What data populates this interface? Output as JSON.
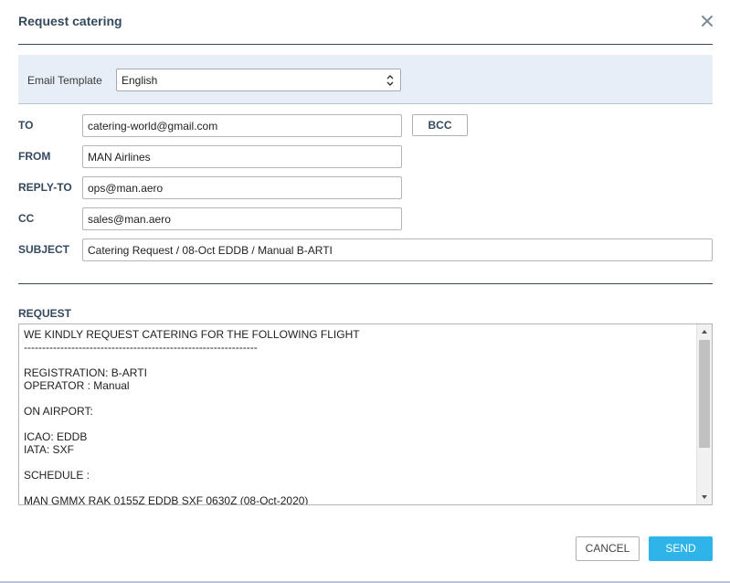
{
  "dialog": {
    "title": "Request catering",
    "close_icon": "close-icon"
  },
  "template": {
    "label": "Email Template",
    "selected": "English"
  },
  "fields": {
    "to": {
      "label": "TO",
      "value": "catering-world@gmail.com"
    },
    "bcc_label": "BCC",
    "from": {
      "label": "FROM",
      "value": "MAN Airlines"
    },
    "reply_to": {
      "label": "REPLY-TO",
      "value": "ops@man.aero"
    },
    "cc": {
      "label": "CC",
      "value": "sales@man.aero"
    },
    "subject": {
      "label": "SUBJECT",
      "value": "Catering Request / 08-Oct EDDB / Manual B-ARTI"
    }
  },
  "request": {
    "label": "REQUEST",
    "lines": [
      "WE KINDLY REQUEST CATERING FOR THE FOLLOWING FLIGHT",
      "----------------------------------------------------------------",
      "",
      "REGISTRATION: B-ARTI",
      "OPERATOR : Manual",
      "",
      "ON AIRPORT:",
      "",
      "ICAO: EDDB",
      "IATA: SXF",
      "",
      "SCHEDULE :",
      "",
      "MAN GMMX RAK 0155Z EDDB SXF 0630Z (08-Oct-2020)"
    ]
  },
  "actions": {
    "cancel_label": "CANCEL",
    "send_label": "SEND"
  },
  "colors": {
    "heading": "#34495e",
    "template_bg": "#e7eef8",
    "send_bg": "#2fb4e9"
  }
}
